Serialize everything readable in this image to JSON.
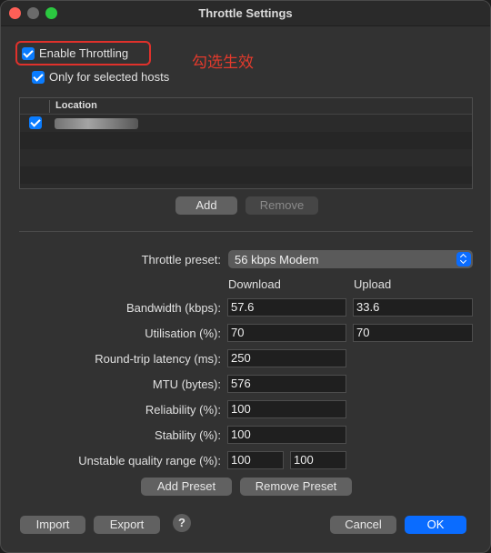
{
  "window": {
    "title": "Throttle Settings"
  },
  "annotation": "勾选生效",
  "enable_throttling": {
    "label": "Enable Throttling",
    "checked": true
  },
  "only_selected_hosts": {
    "label": "Only for selected hosts",
    "checked": true
  },
  "hosts_table": {
    "column": "Location",
    "rows": [
      {
        "checked": true,
        "location_redacted": true
      }
    ]
  },
  "table_buttons": {
    "add": "Add",
    "remove": "Remove"
  },
  "preset": {
    "label": "Throttle preset:",
    "value": "56 kbps Modem"
  },
  "columns": {
    "download": "Download",
    "upload": "Upload"
  },
  "settings": {
    "bandwidth": {
      "label": "Bandwidth (kbps):",
      "download": "57.6",
      "upload": "33.6"
    },
    "utilisation": {
      "label": "Utilisation (%):",
      "download": "70",
      "upload": "70"
    },
    "latency": {
      "label": "Round-trip latency (ms):",
      "value": "250"
    },
    "mtu": {
      "label": "MTU (bytes):",
      "value": "576"
    },
    "reliability": {
      "label": "Reliability (%):",
      "value": "100"
    },
    "stability": {
      "label": "Stability (%):",
      "value": "100"
    },
    "unstable_range": {
      "label": "Unstable quality range (%):",
      "min": "100",
      "max": "100"
    }
  },
  "preset_buttons": {
    "add": "Add Preset",
    "remove": "Remove Preset"
  },
  "footer": {
    "import": "Import",
    "export": "Export",
    "help": "?",
    "cancel": "Cancel",
    "ok": "OK"
  },
  "colors": {
    "accent": "#0a6cff",
    "annotation": "#e23a2c"
  }
}
